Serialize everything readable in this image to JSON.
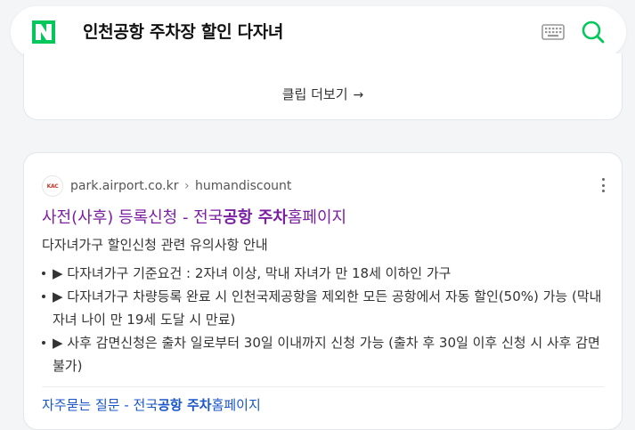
{
  "search": {
    "query": "인천공항 주차장 할인 다자녀",
    "logo_letter": "N",
    "logo_color": "#03c75a",
    "search_icon_color": "#03c75a"
  },
  "clip_card": {
    "more_label": "클립 더보기",
    "more_arrow": "→"
  },
  "result": {
    "favicon_text": "KAC",
    "site_domain": "park.airport.co.kr",
    "site_separator": "›",
    "site_path": "humandiscount",
    "title_parts": [
      "사전(사후) 등록신청 - 전국",
      "공항 주차",
      "홈페이지"
    ],
    "title_color": "#7b1fa2",
    "description": "다자녀가구 할인신청 관련 유의사항 안내",
    "bullets": [
      "▶ 다자녀가구 기준요건 : 2자녀 이상, 막내 자녀가 만 18세 이하인 가구",
      "▶ 다자녀가구 차량등록 완료 시 인천국제공항을 제외한 모든 공항에서 자동 할인(50%) 가능 (막내 자녀 나이 만 19세 도달 시 만료)",
      "▶ 사후 감면신청은 출차 일로부터 30일 이내까지 신청 가능 (출차 후 30일 이후 신청 시 사후 감면 불가)"
    ],
    "sublink_parts": [
      "자주묻는 질문 - 전국",
      "공항 주차",
      "홈페이지"
    ],
    "sublink_color": "#1a56c9"
  }
}
